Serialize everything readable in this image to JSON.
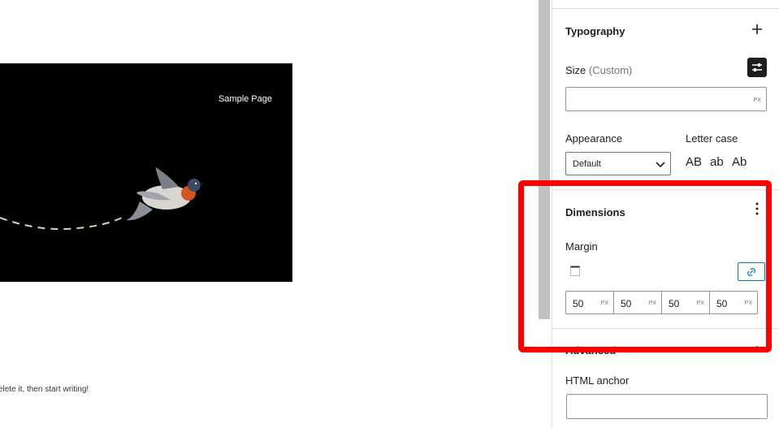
{
  "canvas": {
    "hero_nav_label": "Sample Page",
    "body_text": "elete it, then start writing!"
  },
  "sidebar": {
    "typography": {
      "title": "Typography",
      "add_icon": "plus-icon",
      "size_label": "Size",
      "size_mode": "(Custom)",
      "size_value": "",
      "size_unit": "PX",
      "settings_icon": "sliders-icon",
      "appearance_label": "Appearance",
      "appearance_value": "Default",
      "letter_case_label": "Letter case",
      "letter_case_options": [
        "AB",
        "ab",
        "Ab"
      ]
    },
    "dimensions": {
      "title": "Dimensions",
      "menu_icon": "more-vertical-icon",
      "margin_label": "Margin",
      "side_icon": "box-sides-icon",
      "link_icon": "unlink-icon",
      "values": [
        {
          "value": "50",
          "unit": "PX"
        },
        {
          "value": "50",
          "unit": "PX"
        },
        {
          "value": "50",
          "unit": "PX"
        },
        {
          "value": "50",
          "unit": "PX"
        }
      ]
    },
    "advanced": {
      "title": "Advanced",
      "toggle_icon": "chevron-up-icon",
      "anchor_label": "HTML anchor",
      "anchor_value": ""
    }
  },
  "colors": {
    "highlight": "#ff0000",
    "accent": "#007cba",
    "hero_background": "#000000"
  }
}
